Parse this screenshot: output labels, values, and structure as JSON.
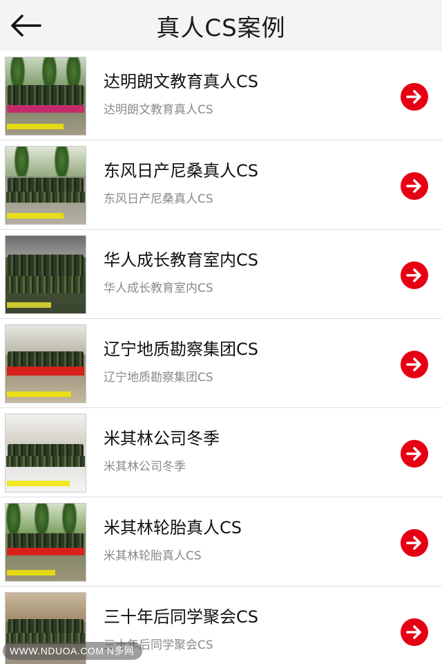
{
  "header": {
    "title": "真人CS案例"
  },
  "colors": {
    "accent": "#e60013"
  },
  "items": [
    {
      "title": "达明朗文教育真人CS",
      "subtitle": "达明朗文教育真人CS",
      "scene": "forest-banner"
    },
    {
      "title": "东风日产尼桑真人CS",
      "subtitle": "东风日产尼桑真人CS",
      "scene": "village-trees"
    },
    {
      "title": "华人成长教育室内CS",
      "subtitle": "华人成长教育室内CS",
      "scene": "indoor-group"
    },
    {
      "title": "辽宁地质勘察集团CS",
      "subtitle": "辽宁地质勘察集团CS",
      "scene": "bare-trees-banner"
    },
    {
      "title": "米其林公司冬季",
      "subtitle": "米其林公司冬季",
      "scene": "winter-field"
    },
    {
      "title": "米其林轮胎真人CS",
      "subtitle": "米其林轮胎真人CS",
      "scene": "forest-red-banner"
    },
    {
      "title": "三十年后同学聚会CS",
      "subtitle": "三十年后同学聚会CS",
      "scene": "building-group"
    }
  ],
  "watermark": {
    "text": "WWW.NDUOA.COM N多网"
  }
}
